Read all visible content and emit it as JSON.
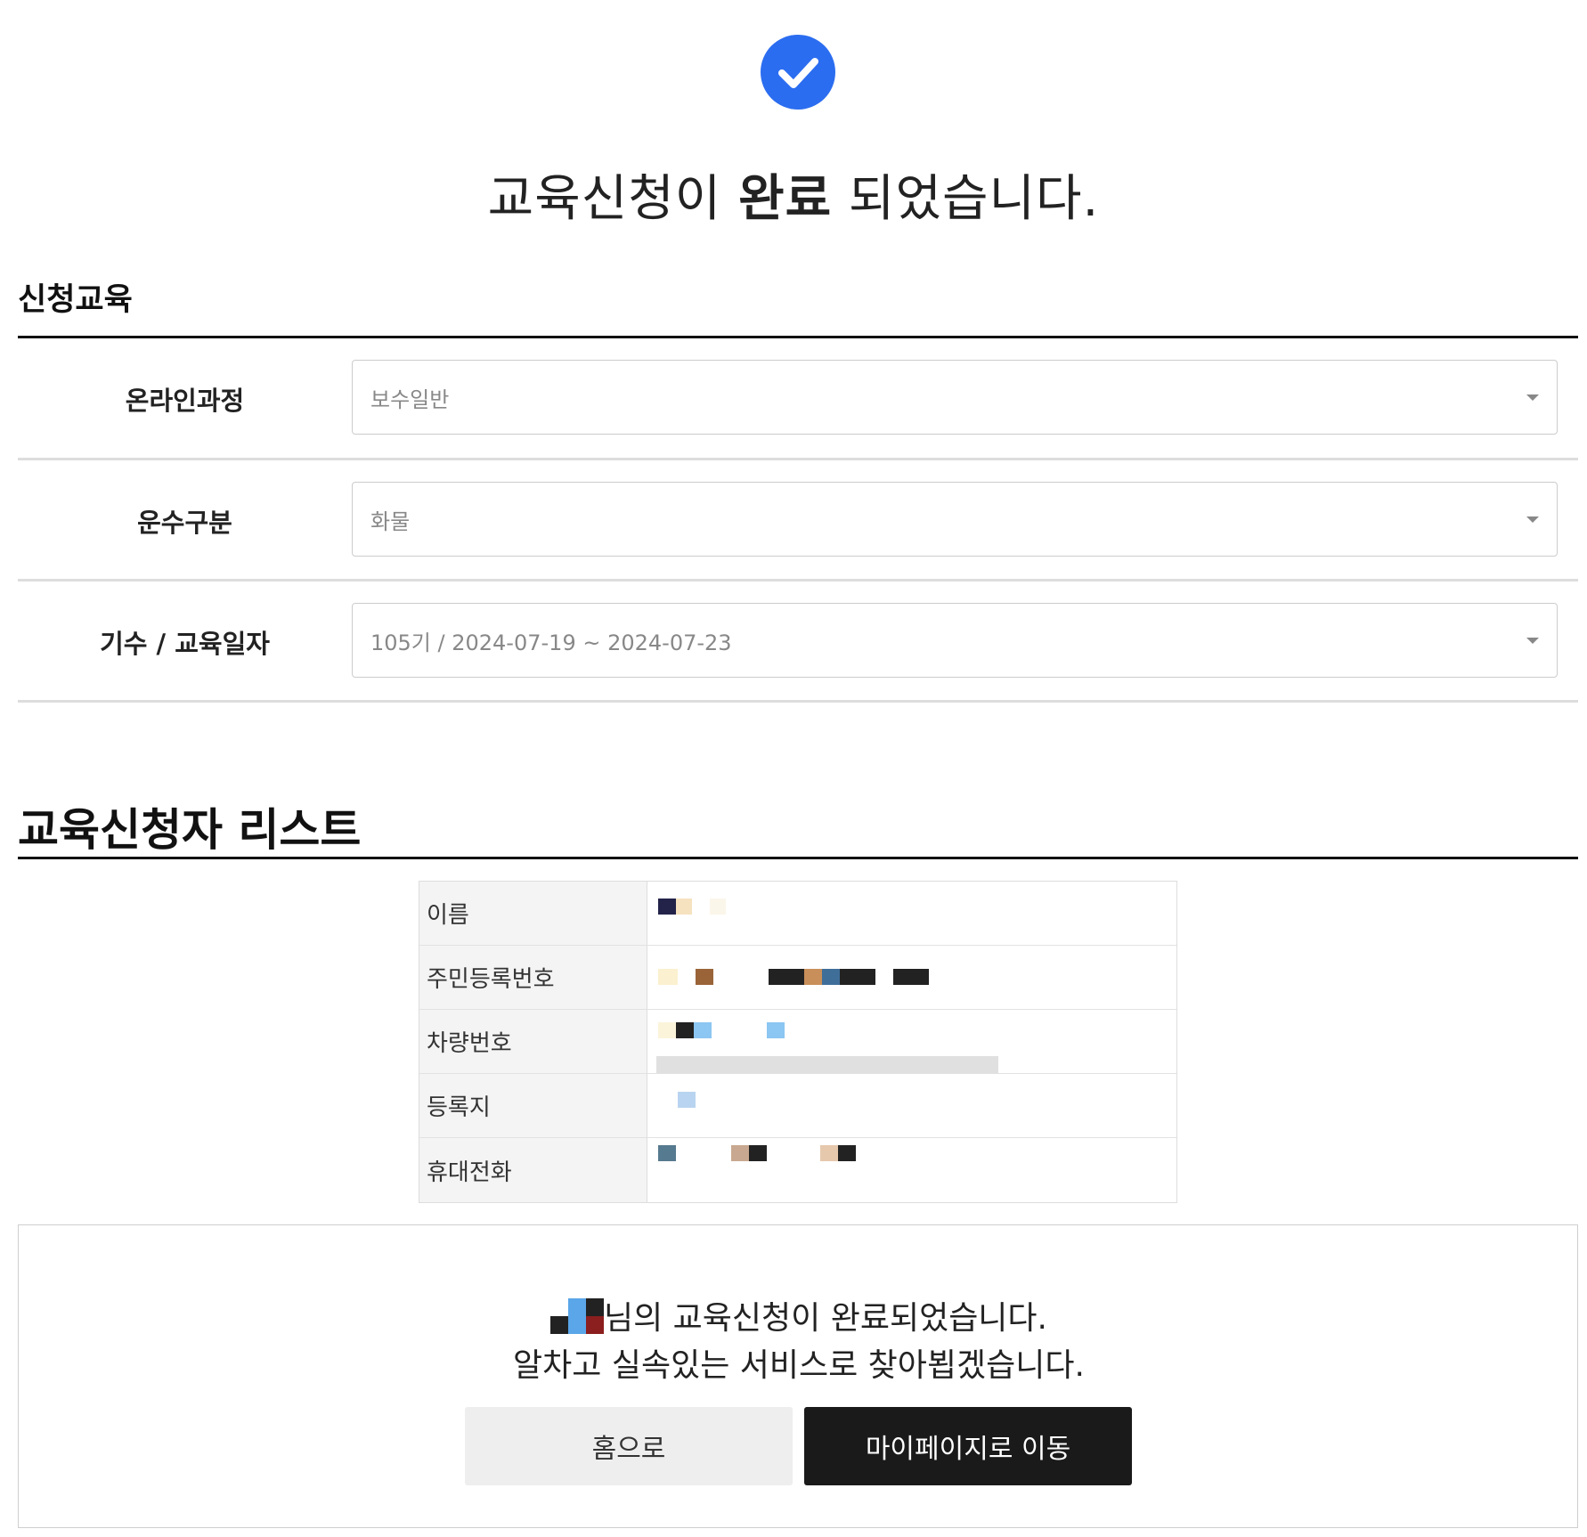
{
  "icons": {
    "success": "check-circle-icon",
    "dropdown": "chevron-down-icon"
  },
  "colors": {
    "accent": "#2b6df0",
    "primary_button": "#1a1a1a",
    "secondary_button": "#eeeeee"
  },
  "header": {
    "title_prefix": "교육신청이 ",
    "title_strong": "완료",
    "title_suffix": " 되었습니다."
  },
  "course_section": {
    "title": "신청교육",
    "rows": [
      {
        "label": "온라인과정",
        "value": "보수일반"
      },
      {
        "label": "운수구분",
        "value": "화물"
      },
      {
        "label": "기수 / 교육일자",
        "value": "105기 / 2024-07-19 ~ 2024-07-23"
      }
    ]
  },
  "applicant_section": {
    "title": "교육신청자 리스트",
    "rows": [
      {
        "label": "이름"
      },
      {
        "label": "주민등록번호"
      },
      {
        "label": "차량번호"
      },
      {
        "label": "등록지"
      },
      {
        "label": "휴대전화"
      }
    ]
  },
  "message": {
    "line1_suffix": "님의 교육신청이 완료되었습니다.",
    "line2": "알차고 실속있는 서비스로 찾아뵙겠습니다."
  },
  "buttons": {
    "home": "홈으로",
    "mypage": "마이페이지로 이동"
  }
}
